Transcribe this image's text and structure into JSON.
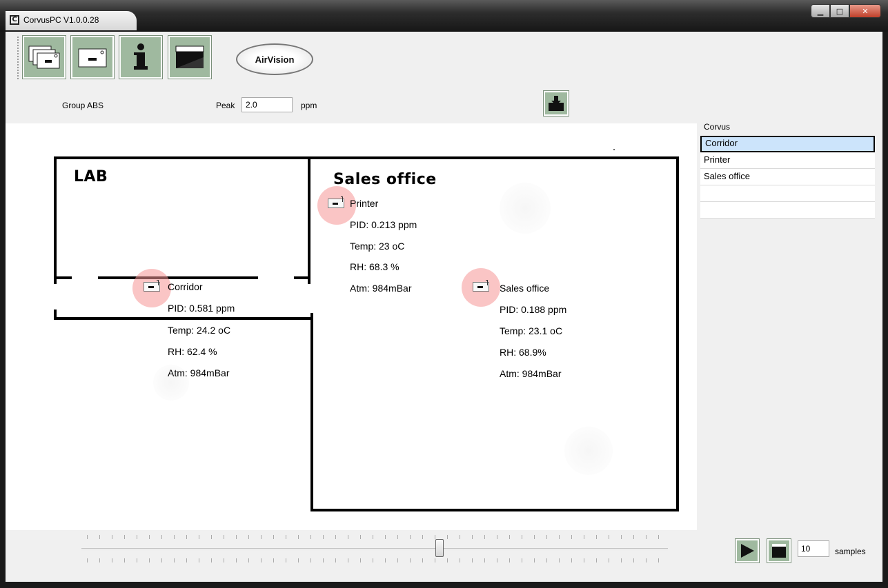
{
  "window": {
    "title": "CorvusPC V1.0.0.28",
    "app_icon_glyph": "C",
    "controls": [
      "minimize",
      "maximize",
      "close"
    ]
  },
  "toolbar": {
    "buttons": [
      {
        "name": "multi-device-button",
        "icon": "stacked-devices-icon"
      },
      {
        "name": "device-button",
        "icon": "device-icon"
      },
      {
        "name": "info-button",
        "icon": "info-icon"
      },
      {
        "name": "sidebar-panel-button",
        "icon": "panel-icon"
      }
    ],
    "logo_text": "AirVision"
  },
  "filter": {
    "group_label": "Group ABS",
    "peak_label": "Peak",
    "peak_value": "2.0",
    "unit": "ppm"
  },
  "map": {
    "rooms": [
      {
        "label": "LAB"
      },
      {
        "label": "Sales office"
      }
    ],
    "sensors": [
      {
        "name": "Printer",
        "pid": "PID: 0.213 ppm",
        "temp": "Temp: 23 oC",
        "rh": "RH: 68.3 %",
        "atm": "Atm: 984mBar"
      },
      {
        "name": "Corridor",
        "pid": "PID: 0.581 ppm",
        "temp": "Temp: 24.2 oC",
        "rh": "RH: 62.4 %",
        "atm": "Atm: 984mBar"
      },
      {
        "name": "Sales office",
        "pid": "PID: 0.188 ppm",
        "temp": "Temp: 23.1 oC",
        "rh": "RH: 68.9%",
        "atm": "Atm: 984mBar"
      }
    ]
  },
  "side": {
    "group_title": "Corvus",
    "items": [
      "Corridor",
      "Printer",
      "Sales office",
      "",
      ""
    ],
    "selected_index": 0
  },
  "playback": {
    "slider_fraction": 0.61,
    "samples_value": "10",
    "samples_label": "samples"
  },
  "colors": {
    "button_green": "#9fb99f",
    "selection": "#cce4fb",
    "sensor_glow": "#f59696"
  }
}
